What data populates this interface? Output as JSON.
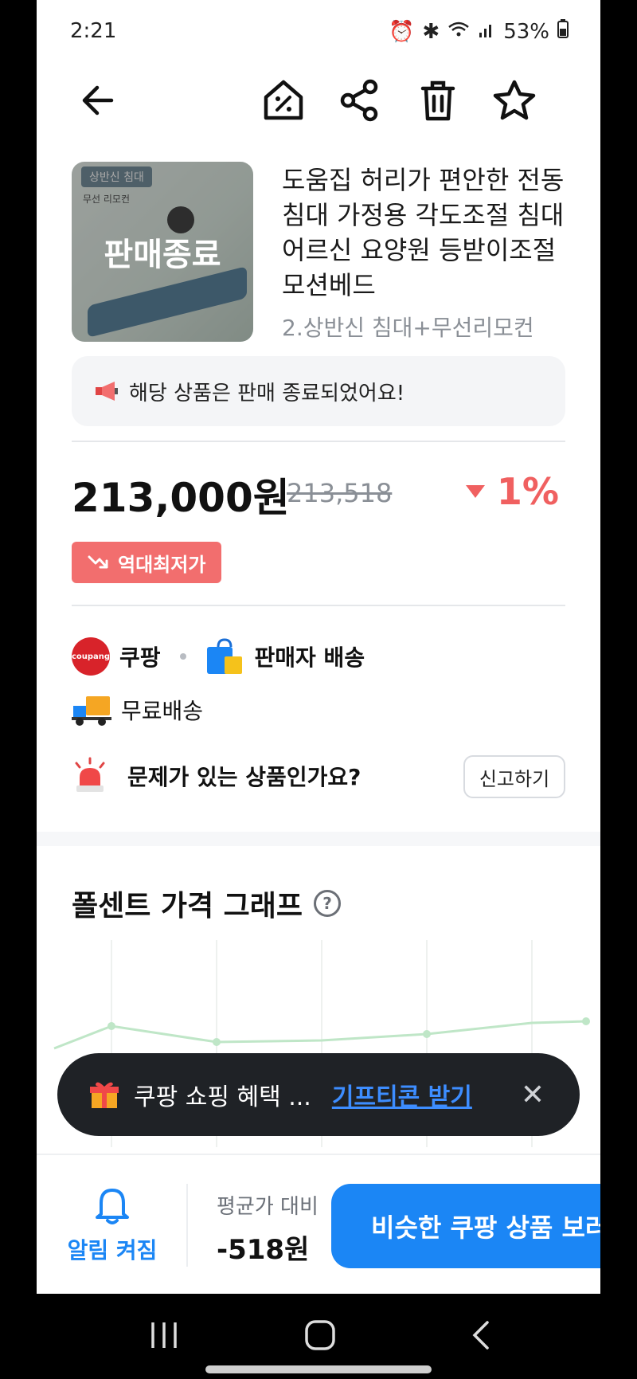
{
  "status": {
    "time": "2:21",
    "battery": "53%"
  },
  "product": {
    "image_tag": "상반신 침대",
    "image_sub": "무선 리모컨",
    "sold_out_overlay": "판매종료",
    "title": "도움집 허리가 편안한 전동침대 가정용 각도조절 침대 어르신 요양원 등받이조절 모션베드",
    "option": "2.상반신 침대+무선리모컨"
  },
  "notice": "해당 상품은 판매 종료되었어요!",
  "price": {
    "current": "213,000원",
    "original": "213,518",
    "change": "1%",
    "lowest_badge": "역대최저가"
  },
  "seller": {
    "store": "쿠팡",
    "store_logo_text": "coupang",
    "delivery_type": "판매자 배송",
    "shipping": "무료배송"
  },
  "report": {
    "question": "문제가 있는 상품인가요?",
    "button": "신고하기"
  },
  "graph": {
    "title": "폴센트 가격 그래프"
  },
  "toast": {
    "text": "쿠팡 쇼핑 혜택 ...",
    "link": "기프티콘 받기"
  },
  "bottom": {
    "alarm_label": "알림 켜짐",
    "avg_label": "평균가 대비",
    "avg_value": "-518원",
    "cta": "비슷한 쿠팡 상품 보러가기"
  },
  "colors": {
    "accent_blue": "#1b86f5",
    "price_down_red": "#f06060",
    "badge_red": "#f26e6e"
  }
}
